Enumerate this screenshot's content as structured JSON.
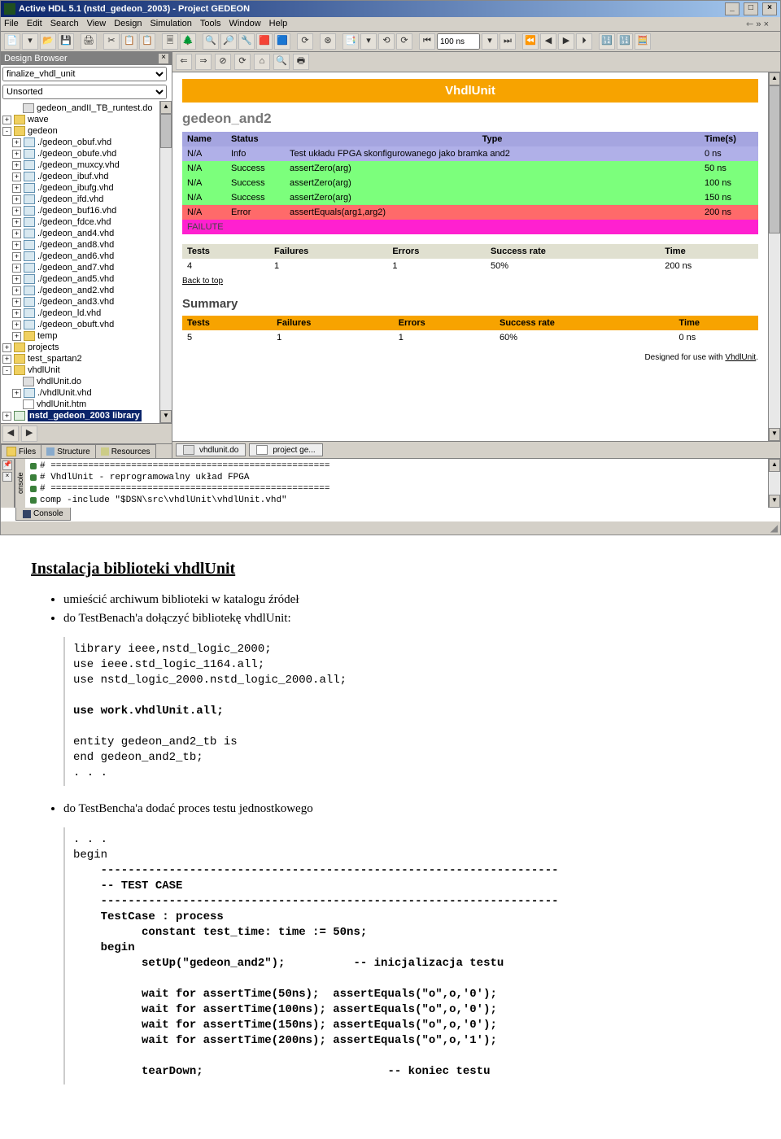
{
  "window": {
    "title": "Active HDL 5.1 (nstd_gedeon_2003) - Project GEDEON",
    "menus": [
      "File",
      "Edit",
      "Search",
      "View",
      "Design",
      "Simulation",
      "Tools",
      "Window",
      "Help"
    ],
    "far_symbols": "⇽  »  ×"
  },
  "toolbar": {
    "time_value": "100 ns",
    "buttons": [
      "📄",
      "▾",
      "📂",
      "💾",
      "",
      "🖨",
      "",
      "✂",
      "📋",
      "📋",
      "",
      "🗏",
      "🌲",
      "",
      "🔍",
      "🔎",
      "🔧",
      "🟥",
      "🟦",
      "",
      "⟳",
      "",
      "⊛",
      "",
      "📑",
      "▾",
      "⟲",
      "⟳",
      "",
      "⏮",
      "⏭",
      "",
      "⏪",
      "◀",
      "▶",
      "⏵",
      "",
      "🔢",
      "🔢",
      "🧮"
    ]
  },
  "design_browser": {
    "title": "Design Browser",
    "combo": "finalize_vhdl_unit",
    "sort_label": "Unsorted",
    "tree": [
      {
        "ind": 1,
        "exp": "",
        "ic": "do",
        "t": "gedeon_andII_TB_runtest.do"
      },
      {
        "ind": 0,
        "exp": "+",
        "ic": "fld",
        "t": "wave"
      },
      {
        "ind": 0,
        "exp": "-",
        "ic": "fld",
        "t": "gedeon"
      },
      {
        "ind": 1,
        "exp": "+",
        "ic": "fil",
        "t": "./gedeon_obuf.vhd"
      },
      {
        "ind": 1,
        "exp": "+",
        "ic": "fil",
        "t": "./gedeon_obufe.vhd"
      },
      {
        "ind": 1,
        "exp": "+",
        "ic": "fil",
        "t": "./gedeon_muxcy.vhd"
      },
      {
        "ind": 1,
        "exp": "+",
        "ic": "fil",
        "t": "./gedeon_ibuf.vhd"
      },
      {
        "ind": 1,
        "exp": "+",
        "ic": "fil",
        "t": "./gedeon_ibufg.vhd"
      },
      {
        "ind": 1,
        "exp": "+",
        "ic": "fil",
        "t": "./gedeon_ifd.vhd"
      },
      {
        "ind": 1,
        "exp": "+",
        "ic": "fil",
        "t": "./gedeon_buf16.vhd"
      },
      {
        "ind": 1,
        "exp": "+",
        "ic": "fil",
        "t": "./gedeon_fdce.vhd"
      },
      {
        "ind": 1,
        "exp": "+",
        "ic": "fil",
        "t": "./gedeon_and4.vhd"
      },
      {
        "ind": 1,
        "exp": "+",
        "ic": "fil",
        "t": "./gedeon_and8.vhd"
      },
      {
        "ind": 1,
        "exp": "+",
        "ic": "fil",
        "t": "./gedeon_and6.vhd"
      },
      {
        "ind": 1,
        "exp": "+",
        "ic": "fil",
        "t": "./gedeon_and7.vhd"
      },
      {
        "ind": 1,
        "exp": "+",
        "ic": "fil",
        "t": "./gedeon_and5.vhd"
      },
      {
        "ind": 1,
        "exp": "+",
        "ic": "fil",
        "t": "./gedeon_and2.vhd"
      },
      {
        "ind": 1,
        "exp": "+",
        "ic": "fil",
        "t": "./gedeon_and3.vhd"
      },
      {
        "ind": 1,
        "exp": "+",
        "ic": "fil",
        "t": "./gedeon_ld.vhd"
      },
      {
        "ind": 1,
        "exp": "+",
        "ic": "fil",
        "t": "./gedeon_obuft.vhd"
      },
      {
        "ind": 1,
        "exp": "+",
        "ic": "fld",
        "t": "temp"
      },
      {
        "ind": 0,
        "exp": "+",
        "ic": "fld",
        "t": "projects"
      },
      {
        "ind": 0,
        "exp": "+",
        "ic": "fld",
        "t": "test_spartan2"
      },
      {
        "ind": 0,
        "exp": "-",
        "ic": "fld",
        "t": "vhdlUnit"
      },
      {
        "ind": 1,
        "exp": "",
        "ic": "do",
        "t": "vhdlUnit.do"
      },
      {
        "ind": 1,
        "exp": "+",
        "ic": "fil",
        "t": "./vhdlUnit.vhd"
      },
      {
        "ind": 1,
        "exp": "",
        "ic": "htm",
        "t": "vhdlUnit.htm"
      },
      {
        "ind": 0,
        "exp": "+",
        "ic": "lib",
        "t": "nstd_gedeon_2003 library",
        "sel": true
      }
    ],
    "tabs": [
      "Files",
      "Structure",
      "Resources"
    ]
  },
  "report": {
    "banner": "VhdlUnit",
    "suite": "gedeon_and2",
    "cols": [
      "Name",
      "Status",
      "Type",
      "Time(s)"
    ],
    "rows": [
      {
        "cls": "row-info",
        "c": [
          "N/A",
          "Info",
          "Test układu FPGA skonfigurowanego jako bramka and2",
          "0 ns"
        ]
      },
      {
        "cls": "row-pass",
        "c": [
          "N/A",
          "Success",
          "assertZero(arg)",
          "50 ns"
        ]
      },
      {
        "cls": "row-pass",
        "c": [
          "N/A",
          "Success",
          "assertZero(arg)",
          "100 ns"
        ]
      },
      {
        "cls": "row-pass",
        "c": [
          "N/A",
          "Success",
          "assertZero(arg)",
          "150 ns"
        ]
      },
      {
        "cls": "row-fail",
        "c": [
          "N/A",
          "Error",
          "assertEquals(arg1,arg2)",
          "200 ns"
        ]
      }
    ],
    "failbar": "FAILUTE",
    "stats_cols": [
      "Tests",
      "Failures",
      "Errors",
      "Success rate",
      "Time"
    ],
    "stats_row": [
      "4",
      "1",
      "1",
      "50%",
      "200 ns"
    ],
    "back": "Back to top",
    "summary_label": "Summary",
    "summary_row": [
      "5",
      "1",
      "1",
      "60%",
      "0 ns"
    ],
    "footer_pre": "Designed for use with ",
    "footer_link": "VhdlUnit",
    "right_tabs": [
      "vhdlunit.do",
      "project ge..."
    ]
  },
  "console": {
    "side": "onsole",
    "lines": [
      "# ====================================================",
      "# VhdlUnit - reprogramowalny układ FPGA",
      "# ====================================================",
      "comp -include \"$DSN\\src\\vhdlUnit\\vhdlUnit.vhd\""
    ],
    "tab": "Console"
  },
  "doc": {
    "h": "Instalacja biblioteki vhdlUnit",
    "b1": "umieścić archiwum biblioteki w katalogu źródeł",
    "b2": "do TestBenach'a dołączyć bibliotekę vhdlUnit:",
    "code1_plain1": "library ieee,nstd_logic_2000;\nuse ieee.std_logic_1164.all;\nuse nstd_logic_2000.nstd_logic_2000.all;\n",
    "code1_bold": "use work.vhdlUnit.all;",
    "code1_plain2": "\n\nentity gedeon_and2_tb is\nend gedeon_and2_tb;\n. . .",
    "b3": "do TestBencha'a dodać proces testu jednostkowego",
    "code2_plain1": ". . .\nbegin",
    "code2_bold": "    -------------------------------------------------------------------\n    -- TEST CASE\n    -------------------------------------------------------------------\n    TestCase : process\n          constant test_time: time := 50ns;\n    begin\n          setUp(\"gedeon_and2\");          -- inicjalizacja testu\n\n          wait for assertTime(50ns);  assertEquals(\"o\",o,'0');\n          wait for assertTime(100ns); assertEquals(\"o\",o,'0');\n          wait for assertTime(150ns); assertEquals(\"o\",o,'0');\n          wait for assertTime(200ns); assertEquals(\"o\",o,'1');\n\n          tearDown;                           -- koniec testu"
  }
}
